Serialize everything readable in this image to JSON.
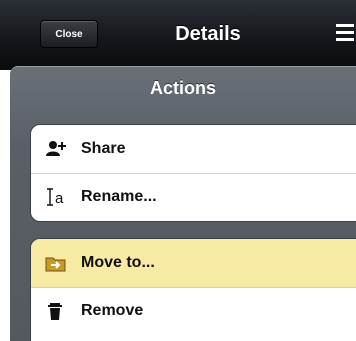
{
  "navbar": {
    "close_label": "Close",
    "title": "Details",
    "menu_icon": "hamburger-menu-icon"
  },
  "popover": {
    "title": "Actions",
    "groups": [
      {
        "items": [
          {
            "label": "Share",
            "icon": "add-person-icon"
          },
          {
            "label": "Rename...",
            "icon": "text-cursor-icon"
          }
        ]
      },
      {
        "items": [
          {
            "label": "Move to...",
            "icon": "folder-move-icon",
            "selected": true
          },
          {
            "label": "Remove",
            "icon": "trash-icon"
          }
        ]
      }
    ]
  },
  "colors": {
    "navbar": "#14171b",
    "popover": "#5a5f67",
    "selected_row": "#f8e9a4"
  }
}
